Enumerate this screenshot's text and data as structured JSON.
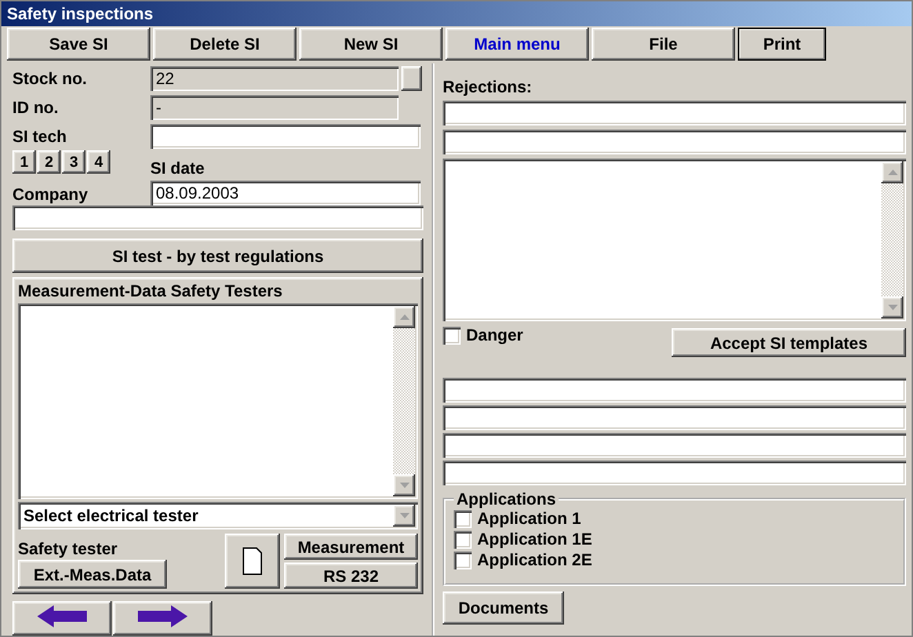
{
  "window": {
    "title": "Safety inspections"
  },
  "toolbar": [
    {
      "label": "Save SI",
      "kind": "plain"
    },
    {
      "label": "Delete SI",
      "kind": "plain"
    },
    {
      "label": "New SI",
      "kind": "plain"
    },
    {
      "label": "Main menu",
      "kind": "link"
    },
    {
      "label": "File",
      "kind": "plain"
    },
    {
      "label": "Print",
      "kind": "default"
    }
  ],
  "stock_no": {
    "label": "Stock no.",
    "value": "22",
    "disabled": true
  },
  "id_no": {
    "label": "ID no.",
    "value": "-",
    "disabled": true
  },
  "si_tech": {
    "label": "SI tech",
    "disabled": false
  },
  "tech_buttons": [
    "1",
    "2",
    "3",
    "4"
  ],
  "si_date": {
    "label": "SI date",
    "value": "08.09.2003",
    "disabled": false
  },
  "company": {
    "label": "Company",
    "disabled": false
  },
  "si_test_button": "SI test - by test regulations",
  "measurement": {
    "title": "Measurement-Data Safety Testers",
    "select": "Select electrical tester",
    "safety_tester_label": "Safety tester",
    "ext_button": "Ext.-Meas.Data",
    "measurement_button": "Measurement",
    "rs232_button": "RS 232"
  },
  "rejections": {
    "label": "Rejections:"
  },
  "danger": {
    "label": "Danger",
    "checked": false
  },
  "accept_button": "Accept SI templates",
  "applications": {
    "title": "Applications",
    "items": [
      {
        "label": "Application 1",
        "checked": false
      },
      {
        "label": "Application 1E",
        "checked": false
      },
      {
        "label": "Application 2E",
        "checked": false
      }
    ]
  },
  "documents_button": "Documents"
}
